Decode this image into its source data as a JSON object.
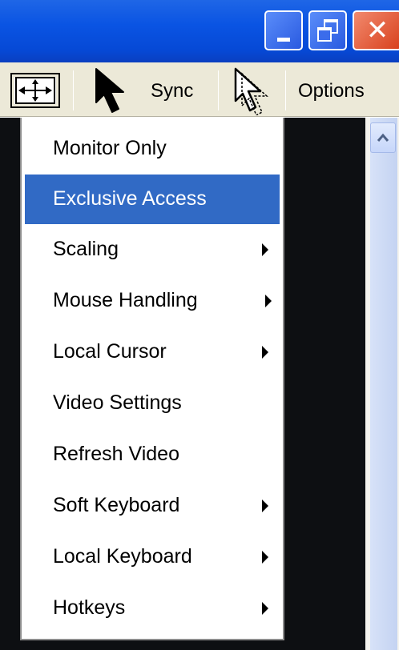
{
  "window_controls": {
    "minimize": "minimize-icon",
    "maximize": "restore-icon",
    "close": "close-icon"
  },
  "toolbar": {
    "sync_label": "Sync",
    "options_label": "Options"
  },
  "menu": {
    "items": [
      {
        "label": "Monitor Only",
        "submenu": false,
        "selected": false
      },
      {
        "label": "Exclusive Access",
        "submenu": false,
        "selected": true
      },
      {
        "label": "Scaling",
        "submenu": true,
        "selected": false
      },
      {
        "label": "Mouse Handling",
        "submenu": true,
        "selected": false
      },
      {
        "label": "Local Cursor",
        "submenu": true,
        "selected": false
      },
      {
        "label": "Video Settings",
        "submenu": false,
        "selected": false
      },
      {
        "label": "Refresh Video",
        "submenu": false,
        "selected": false
      },
      {
        "label": "Soft Keyboard",
        "submenu": true,
        "selected": false
      },
      {
        "label": "Local Keyboard",
        "submenu": true,
        "selected": false
      },
      {
        "label": "Hotkeys",
        "submenu": true,
        "selected": false
      }
    ]
  },
  "colors": {
    "titlebar": "#0a54e3",
    "highlight": "#316ac5",
    "toolbar": "#ece9d8",
    "video_background": "#0d0f12"
  }
}
